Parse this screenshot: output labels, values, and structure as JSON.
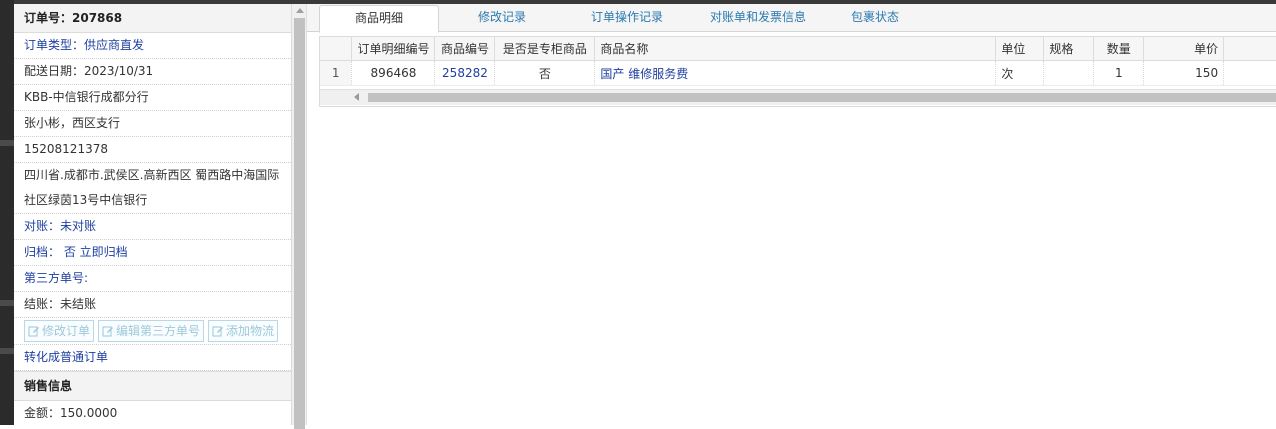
{
  "order": {
    "header": "订单号：207868",
    "type": "订单类型：供应商直发",
    "delivery_date": "配送日期：2023/10/31",
    "customer": "KBB-中信银行成都分行",
    "contact": "张小彬，西区支行",
    "phone": "15208121378",
    "address_line1": "四川省.成都市.武侯区.高新西区 蜀西路中海国际",
    "address_line2": "社区绿茵13号中信银行",
    "reconcile": "对账：未对账",
    "archive": "归档： 否 立即归档",
    "third_party": "第三方单号:",
    "settlement": "结账：未结账",
    "buttons": {
      "edit_order": "修改订单",
      "edit_third_party": "编辑第三方单号",
      "add_logistics": "添加物流"
    },
    "convert": "转化成普通订单"
  },
  "sales": {
    "title": "销售信息",
    "amount": "金额：150.0000"
  },
  "tabs": [
    {
      "label": "商品明细",
      "active": true
    },
    {
      "label": "修改记录",
      "active": false
    },
    {
      "label": "订单操作记录",
      "active": false
    },
    {
      "label": "对账单和发票信息",
      "active": false
    },
    {
      "label": "包裹状态",
      "active": false
    }
  ],
  "grid": {
    "columns": [
      "订单明细编号",
      "商品编号",
      "是否是专柜商品",
      "商品名称",
      "单位",
      "规格",
      "数量",
      "单价"
    ],
    "rows": [
      {
        "row_num": "1",
        "detail_id": "896468",
        "product_id": "258282",
        "is_counter": "否",
        "name": "国产 维修服务费",
        "unit": "次",
        "spec": "",
        "qty": "1",
        "price": "150"
      }
    ]
  },
  "colors": {
    "link": "#1f3fa0",
    "tab_link": "#2a7ab0",
    "disabled_button": "#9cc8da"
  },
  "icons": [
    "edit-icon"
  ]
}
